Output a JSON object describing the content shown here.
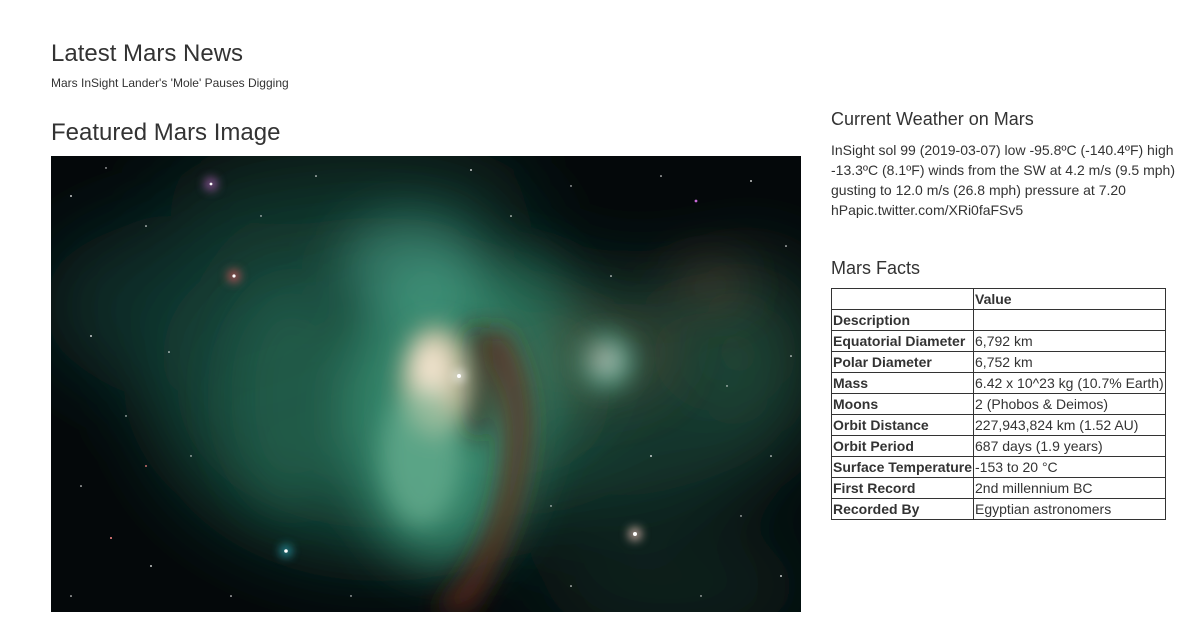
{
  "news": {
    "section_title": "Latest Mars News",
    "headline": "Mars InSight Lander's 'Mole' Pauses Digging"
  },
  "featured": {
    "section_title": "Featured Mars Image"
  },
  "weather": {
    "section_title": "Current Weather on Mars",
    "tweet": "InSight sol 99 (2019-03-07) low -95.8ºC (-140.4ºF) high -13.3ºC (8.1ºF) winds from the SW at 4.2 m/s (9.5 mph) gusting to 12.0 m/s (26.8 mph) pressure at 7.20 hPapic.twitter.com/XRi0faFSv5"
  },
  "facts": {
    "section_title": "Mars Facts",
    "header": {
      "label": "",
      "value": "Value"
    },
    "rows": [
      {
        "label": "Description",
        "value": ""
      },
      {
        "label": "Equatorial Diameter",
        "value": "6,792 km"
      },
      {
        "label": "Polar Diameter",
        "value": "6,752 km"
      },
      {
        "label": "Mass",
        "value": "6.42 x 10^23 kg (10.7% Earth)"
      },
      {
        "label": "Moons",
        "value": "2 (Phobos & Deimos)"
      },
      {
        "label": "Orbit Distance",
        "value": "227,943,824 km (1.52 AU)"
      },
      {
        "label": "Orbit Period",
        "value": "687 days (1.9 years)"
      },
      {
        "label": "Surface Temperature",
        "value": "-153 to 20 °C"
      },
      {
        "label": "First Record",
        "value": "2nd millennium BC"
      },
      {
        "label": "Recorded By",
        "value": "Egyptian astronomers"
      }
    ]
  }
}
